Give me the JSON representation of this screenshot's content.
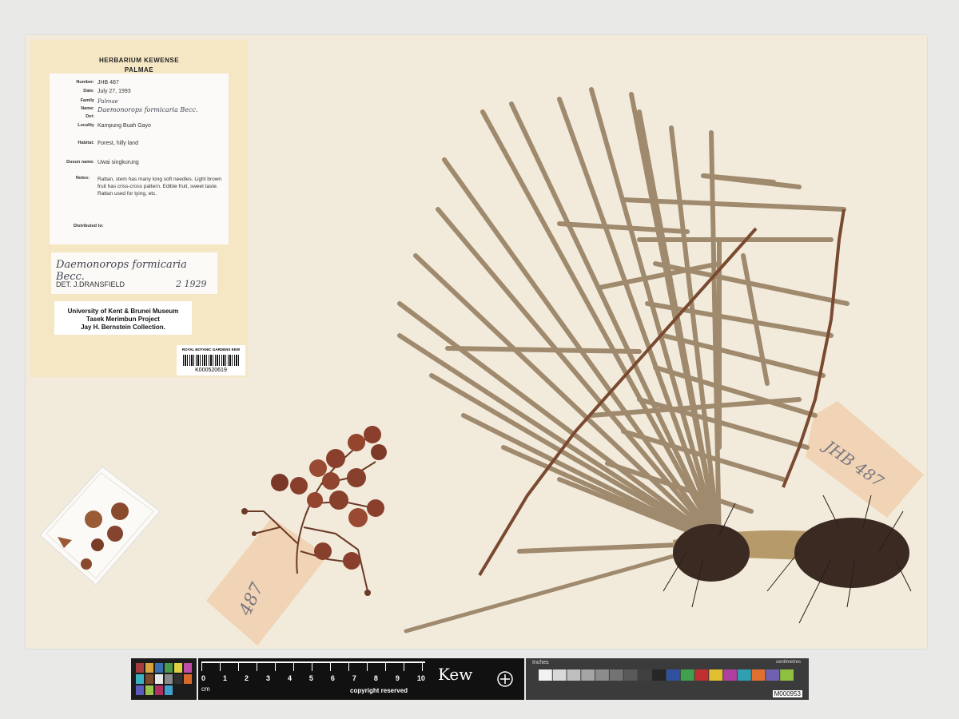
{
  "herbarium": {
    "line1": "HERBARIUM KEWENSE",
    "line2": "PALMAE"
  },
  "main_label": {
    "fields": [
      {
        "key": "Number:",
        "value": "JHB 487"
      },
      {
        "key": "Date:",
        "value": "July 27, 1993"
      },
      {
        "key": "Family",
        "value": "Palmae"
      },
      {
        "key": "Name:",
        "value": "Daemonorops formicaria Becc."
      },
      {
        "key": "Det:",
        "value": ""
      },
      {
        "key": "Locality",
        "value": "Kampung Buah Gayo"
      },
      {
        "key": "Habitat:",
        "value": "Forest, hilly land"
      },
      {
        "key": "Dusun name:",
        "value": "Uwai singkurung"
      },
      {
        "key": "Notes:",
        "value": ""
      }
    ],
    "notes": "Rattan, stem has many long soft needles. Light brown fruit has criss-cross pattern. Edible fruit, sweet taste. Rattan used for tying, etc.",
    "distributed": "Distributed to:"
  },
  "det_label": {
    "name": "Daemonorops formicaria Becc.",
    "det": "DET. J.DRANSFIELD",
    "date": "2 1929"
  },
  "collection_label": {
    "line1": "University of Kent & Brunei Museum",
    "line2": "Tasek Merimbun Project",
    "line3": "Jay H. Bernstein Collection."
  },
  "barcode": {
    "header": "ROYAL BOTANIC GARDENS KEW",
    "number": "K000520619"
  },
  "tags": {
    "fruit_tag": "487",
    "leaf_tag": "JHB 487"
  },
  "scale_bar": {
    "ruler_numbers": [
      "0",
      "1",
      "2",
      "3",
      "4",
      "5",
      "6",
      "7",
      "8",
      "9",
      "10"
    ],
    "unit": "cm",
    "copyright": "copyright reserved",
    "logo": "Kew",
    "inches_label": "Inches",
    "centimetres_label": "centimetres",
    "card_id": "M000953",
    "color_patches_left": [
      "#a53b3b",
      "#d9a23a",
      "#3a6fb0",
      "#4b9a4b",
      "#e0d23e",
      "#c04ca8",
      "#3bb0c0",
      "#7a4a2a",
      "#e8e8e8",
      "#8a8a8a",
      "#303030",
      "#d96a2a",
      "#5a5abf",
      "#9bc24a",
      "#b03060",
      "#40a0d0"
    ],
    "color_patches_right": [
      "#f2f2f2",
      "#d8d8d8",
      "#bfbfbf",
      "#a5a5a5",
      "#8c8c8c",
      "#737373",
      "#595959",
      "#404040",
      "#262626",
      "#3050a0",
      "#40a050",
      "#c03030",
      "#e0c030",
      "#b040a0",
      "#30a0b0",
      "#e07030",
      "#7060b0",
      "#90c040"
    ]
  }
}
